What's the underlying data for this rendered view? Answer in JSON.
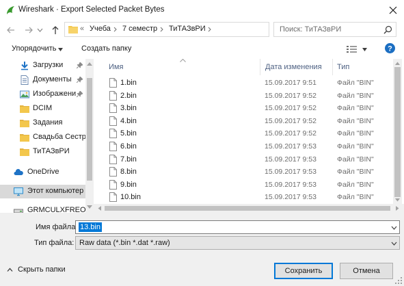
{
  "window": {
    "title": "Wireshark · Export Selected Packet Bytes"
  },
  "address": {
    "crumbs": [
      "Учеба",
      "7 семестр",
      "ТиТАЗвРИ"
    ],
    "overflow": "«"
  },
  "search": {
    "placeholder": "Поиск: ТиТАЗвРИ"
  },
  "toolbar": {
    "organize_label": "Упорядочить",
    "new_folder_label": "Создать папку"
  },
  "nav": {
    "items": [
      {
        "label": "Загрузки",
        "icon": "download-icon",
        "pinned": true
      },
      {
        "label": "Документы",
        "icon": "documents-icon",
        "pinned": true
      },
      {
        "label": "Изображени",
        "icon": "pictures-icon",
        "pinned": true
      },
      {
        "label": "DCIM",
        "icon": "folder-icon",
        "pinned": false
      },
      {
        "label": "Задания",
        "icon": "folder-icon",
        "pinned": false
      },
      {
        "label": "Свадьба Сестре",
        "icon": "folder-icon",
        "pinned": false
      },
      {
        "label": "ТиТАЗвРИ",
        "icon": "folder-icon",
        "pinned": false
      },
      {
        "label": "OneDrive",
        "icon": "cloud-icon",
        "pinned": false
      },
      {
        "label": "Этот компьютер",
        "icon": "computer-icon",
        "pinned": false,
        "selected": true
      },
      {
        "label": "GRMCULXFREO_R",
        "icon": "drive-icon",
        "pinned": false
      }
    ]
  },
  "files": {
    "columns": {
      "name": "Имя",
      "date": "Дата изменения",
      "type": "Тип"
    },
    "rows": [
      {
        "name": "1.bin",
        "date": "15.09.2017 9:51",
        "type": "Файл \"BIN\""
      },
      {
        "name": "2.bin",
        "date": "15.09.2017 9:52",
        "type": "Файл \"BIN\""
      },
      {
        "name": "3.bin",
        "date": "15.09.2017 9:52",
        "type": "Файл \"BIN\""
      },
      {
        "name": "4.bin",
        "date": "15.09.2017 9:52",
        "type": "Файл \"BIN\""
      },
      {
        "name": "5.bin",
        "date": "15.09.2017 9:52",
        "type": "Файл \"BIN\""
      },
      {
        "name": "6.bin",
        "date": "15.09.2017 9:53",
        "type": "Файл \"BIN\""
      },
      {
        "name": "7.bin",
        "date": "15.09.2017 9:53",
        "type": "Файл \"BIN\""
      },
      {
        "name": "8.bin",
        "date": "15.09.2017 9:53",
        "type": "Файл \"BIN\""
      },
      {
        "name": "9.bin",
        "date": "15.09.2017 9:53",
        "type": "Файл \"BIN\""
      },
      {
        "name": "10.bin",
        "date": "15.09.2017 9:53",
        "type": "Файл \"BIN\""
      }
    ]
  },
  "form": {
    "filename_label": "Имя файла:",
    "filename_value": "13.bin",
    "filetype_label": "Тип файла:",
    "filetype_value": "Raw data (*.bin *.dat *.raw)"
  },
  "footer": {
    "hide_folders_label": "Скрыть папки",
    "save_label": "Сохранить",
    "cancel_label": "Отмена"
  },
  "colors": {
    "accent": "#0078d7",
    "wireshark_green": "#3a9a2f",
    "folder_yellow": "#f3c74c",
    "help_blue": "#1b6ec2"
  }
}
